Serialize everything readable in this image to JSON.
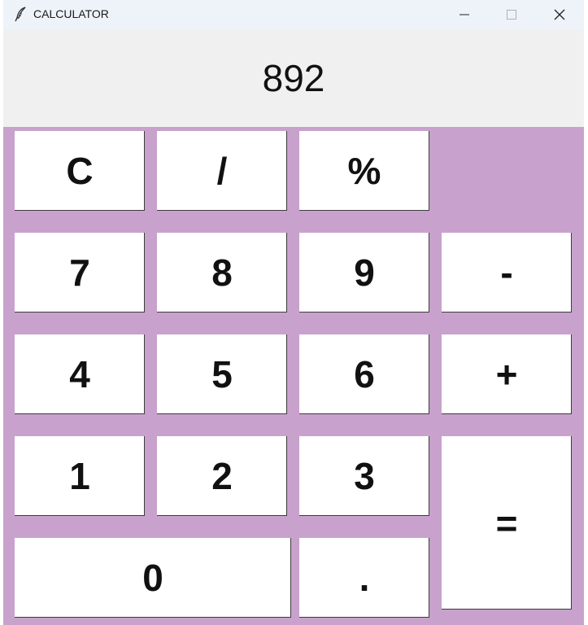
{
  "window": {
    "title": "CALCULATOR",
    "app_icon": "feather-icon",
    "controls": {
      "minimize": "minimize-icon",
      "maximize": "maximize-icon",
      "close": "close-icon"
    }
  },
  "display": {
    "value": "892"
  },
  "keys": {
    "clear": "C",
    "divide": "/",
    "percent": "%",
    "seven": "7",
    "eight": "8",
    "nine": "9",
    "minus": "-",
    "four": "4",
    "five": "5",
    "six": "6",
    "plus": "+",
    "one": "1",
    "two": "2",
    "three": "3",
    "equals": "=",
    "zero": "0",
    "decimal": "."
  },
  "colors": {
    "keypad_background": "#c8a2cc",
    "display_background": "#f0f0f0",
    "key_background": "#ffffff",
    "titlebar_background": "#eef3fa"
  }
}
